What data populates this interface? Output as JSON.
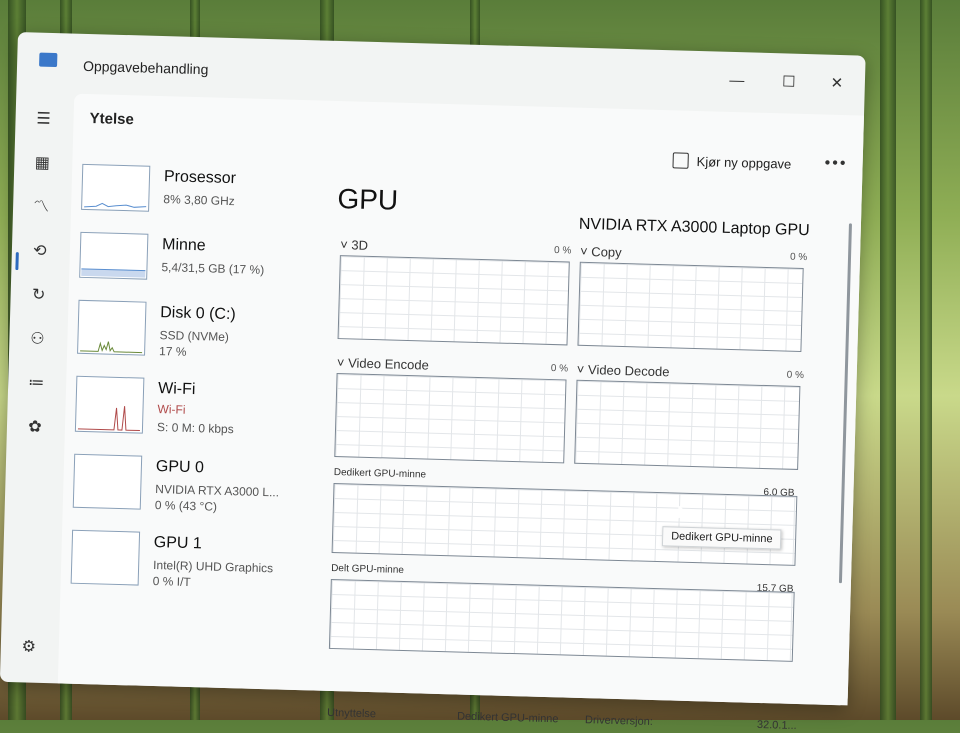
{
  "window": {
    "title": "Oppgavebehandling",
    "minimize": "—",
    "maximize": "☐",
    "close": "✕"
  },
  "header": {
    "page_title": "Ytelse",
    "run_task_label": "Kjør ny oppgave",
    "more_label": "•••"
  },
  "nav_icons": [
    "menu-icon",
    "processes-icon",
    "performance-icon",
    "app-history-icon",
    "startup-icon",
    "users-icon",
    "details-icon",
    "services-icon",
    "settings-icon"
  ],
  "resources": [
    {
      "title": "Prosessor",
      "line1": "8% 3,80 GHz",
      "line2": ""
    },
    {
      "title": "Minne",
      "line1": "5,4/31,5 GB (17 %)",
      "line2": ""
    },
    {
      "title": "Disk 0 (C:)",
      "line1": "SSD (NVMe)",
      "line2": "17 %"
    },
    {
      "title": "Wi-Fi",
      "line1": "Wi-Fi",
      "line2": "S: 0 M: 0 kbps"
    },
    {
      "title": "GPU 0",
      "line1": "NVIDIA RTX A3000 L...",
      "line2": "0 % (43 °C)"
    },
    {
      "title": "GPU 1",
      "line1": "Intel(R) UHD Graphics",
      "line2": "0 % I/T"
    }
  ],
  "gpu": {
    "title": "GPU",
    "name": "NVIDIA RTX A3000 Laptop GPU",
    "engines": [
      {
        "label": "3D",
        "percent": "0 %"
      },
      {
        "label": "Copy",
        "percent": "0 %"
      },
      {
        "label": "Video Encode",
        "percent": "0 %"
      },
      {
        "label": "Video Decode",
        "percent": "0 %"
      }
    ],
    "dedicated_memory": {
      "label": "Dedikert GPU-minne",
      "max": "6,0 GB"
    },
    "shared_memory": {
      "label": "Delt GPU-minne",
      "max": "15,7 GB"
    },
    "tooltip": "Dedikert GPU-minne"
  },
  "footer": {
    "utilization": "Utnyttelse",
    "dedicated": "Dedikert GPU-minne",
    "driver_label": "Driverversjon:",
    "driver_value": "32.0.1..."
  }
}
